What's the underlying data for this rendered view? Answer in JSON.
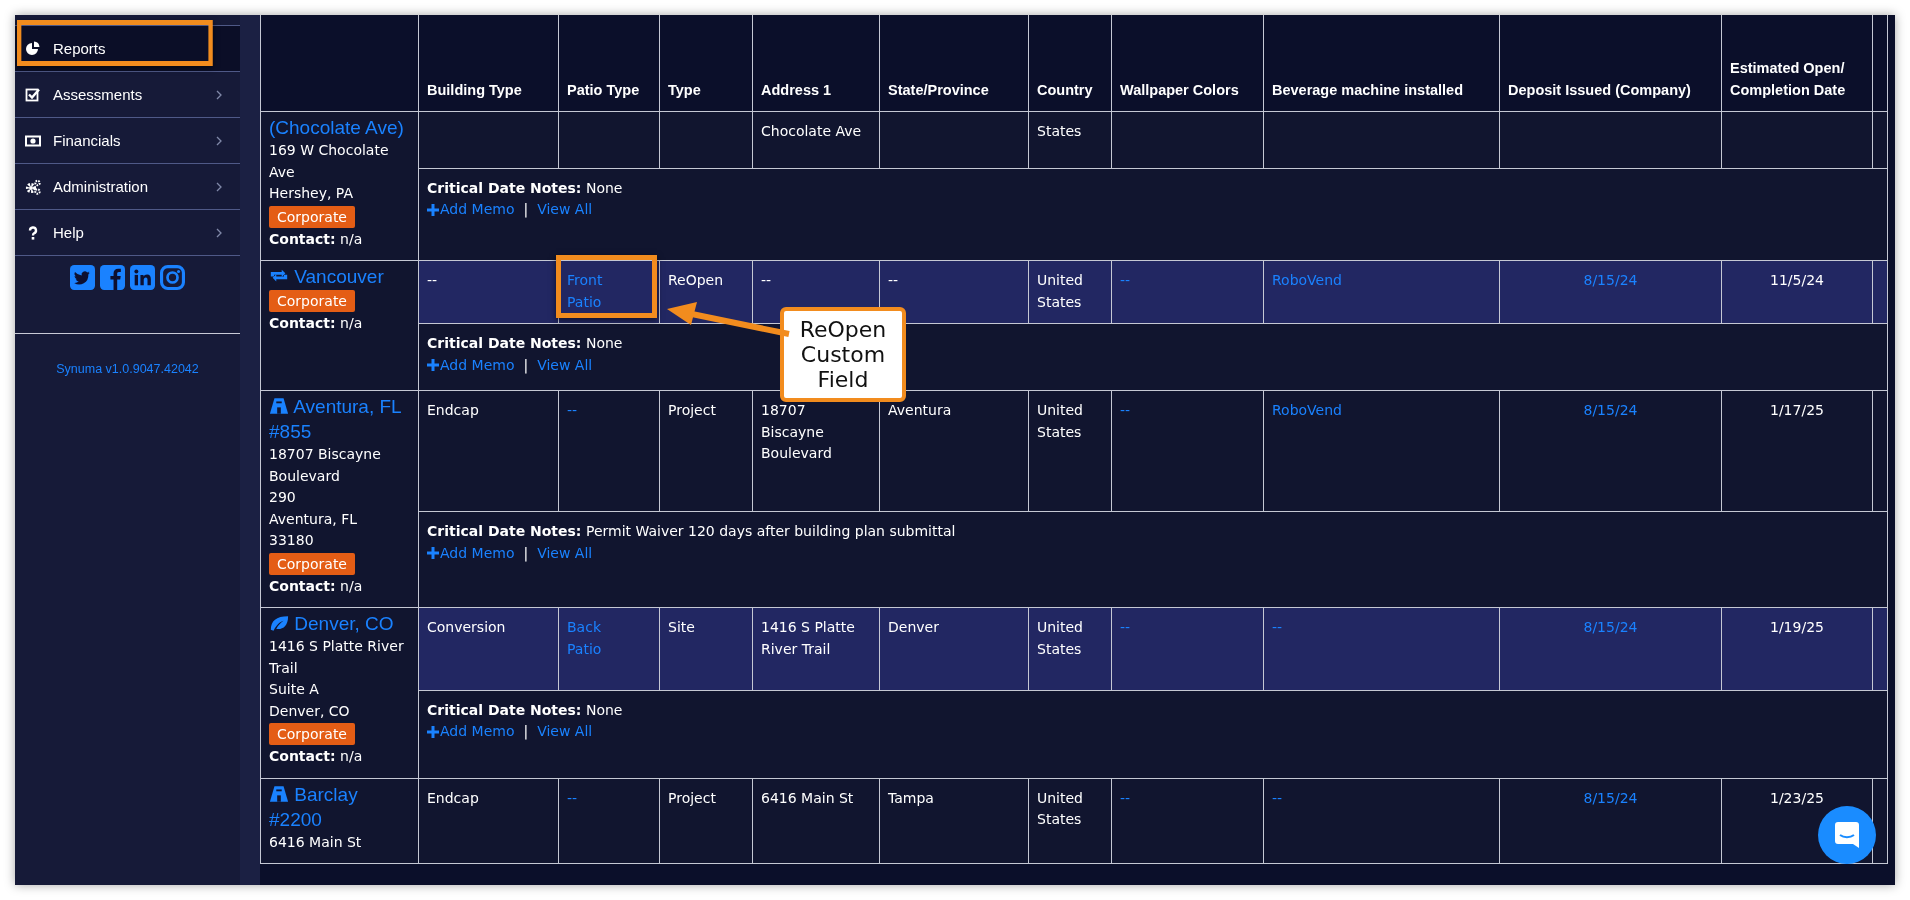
{
  "sidebar": {
    "items": [
      {
        "label": "Reports",
        "kind": "chart",
        "selected": true,
        "annotated": true,
        "has_submenu": false
      },
      {
        "label": "Assessments",
        "kind": "check",
        "selected": false,
        "annotated": false,
        "has_submenu": true
      },
      {
        "label": "Financials",
        "kind": "money",
        "selected": false,
        "annotated": false,
        "has_submenu": true
      },
      {
        "label": "Administration",
        "kind": "gears",
        "selected": false,
        "annotated": false,
        "has_submenu": true
      },
      {
        "label": "Help",
        "kind": "help",
        "selected": false,
        "annotated": false,
        "has_submenu": true
      }
    ],
    "social": [
      {
        "kind": "twitter"
      },
      {
        "kind": "facebook"
      },
      {
        "kind": "linkedin"
      },
      {
        "kind": "instagram"
      }
    ],
    "version": "Synuma v1.0.9047.42042"
  },
  "table": {
    "columns": [
      {
        "label": "Building Type",
        "kind": "text"
      },
      {
        "label": "Patio Type",
        "kind": "link"
      },
      {
        "label": "Type",
        "kind": "text"
      },
      {
        "label": "Address 1",
        "kind": "text"
      },
      {
        "label": "State/Province",
        "kind": "text"
      },
      {
        "label": "Country",
        "kind": "text"
      },
      {
        "label": "Wallpaper Colors",
        "kind": "link"
      },
      {
        "label": "Beverage machine installed",
        "kind": "link"
      },
      {
        "label": "Deposit Issued (Company)",
        "kind": "date-link"
      },
      {
        "label": "Estimated Open/ Completion Date",
        "kind": "date"
      }
    ],
    "rows": [
      {
        "name": "(Chocolate Ave)",
        "address_lines": [
          "169 W Chocolate",
          "Ave",
          "Hershey, PA"
        ],
        "badge": "Corporate",
        "contact": "**Contact:** n/a",
        "highlighted": false,
        "cells": [
          null,
          null,
          null,
          "Chocolate Ave",
          null,
          "States",
          null,
          null,
          null,
          null
        ],
        "notes": {
          "text": "**Critical Date Notes:**  None",
          "add_memo": "Add Memo",
          "separator": "|",
          "view_all": "View All"
        }
      },
      {
        "name": "Vancouver",
        "kind": "reopen",
        "badge": "Corporate",
        "contact": "**Contact:** n/a",
        "highlighted": true,
        "cells": [
          "--",
          {
            "text": "Front Patio",
            "annotated": true
          },
          "ReOpen",
          "--",
          "--",
          "United States",
          "--",
          "RoboVend",
          "8/15/24",
          "11/5/24"
        ],
        "notes": {
          "text": "**Critical Date Notes:**  None",
          "add_memo": "Add Memo",
          "separator": "|",
          "view_all": "View All"
        }
      },
      {
        "name": "Aventura, FL #855",
        "kind": "project",
        "address_lines": [
          "18707 Biscayne",
          "Boulevard",
          "290",
          "Aventura, FL",
          "33180"
        ],
        "badge": "Corporate",
        "contact": "**Contact:** n/a",
        "highlighted": false,
        "cells": [
          "Endcap",
          "--",
          "Project",
          "18707 Biscayne Boulevard",
          "Aventura",
          "United States",
          "--",
          "RoboVend",
          "8/15/24",
          "1/17/25"
        ],
        "notes": {
          "text": "**Critical Date Notes:**  Permit Waiver 120 days after building plan submittal",
          "add_memo": "Add Memo",
          "separator": "|",
          "view_all": "View All"
        }
      },
      {
        "name": "Denver, CO",
        "kind": "site",
        "address_lines": [
          "1416 S Platte River",
          "Trail",
          "Suite A",
          "Denver, CO"
        ],
        "badge": "Corporate",
        "contact": "**Contact:** n/a",
        "highlighted": true,
        "cells": [
          "Conversion",
          "Back Patio",
          "Site",
          "1416 S Platte River Trail",
          "Denver",
          "United States",
          "--",
          "--",
          "8/15/24",
          "1/19/25"
        ],
        "notes": {
          "text": "**Critical Date Notes:**  None",
          "add_memo": "Add Memo",
          "separator": "|",
          "view_all": "View All"
        }
      },
      {
        "name": "Barclay #2200",
        "kind": "project",
        "address_lines": [
          "6416 Main St"
        ],
        "highlighted": false,
        "cells": [
          "Endcap",
          "--",
          "Project",
          "6416 Main St",
          "Tampa",
          "United States",
          "--",
          "--",
          "8/15/24",
          "1/23/25"
        ]
      }
    ]
  },
  "annotation": {
    "callout": "ReOpen Custom Field"
  }
}
